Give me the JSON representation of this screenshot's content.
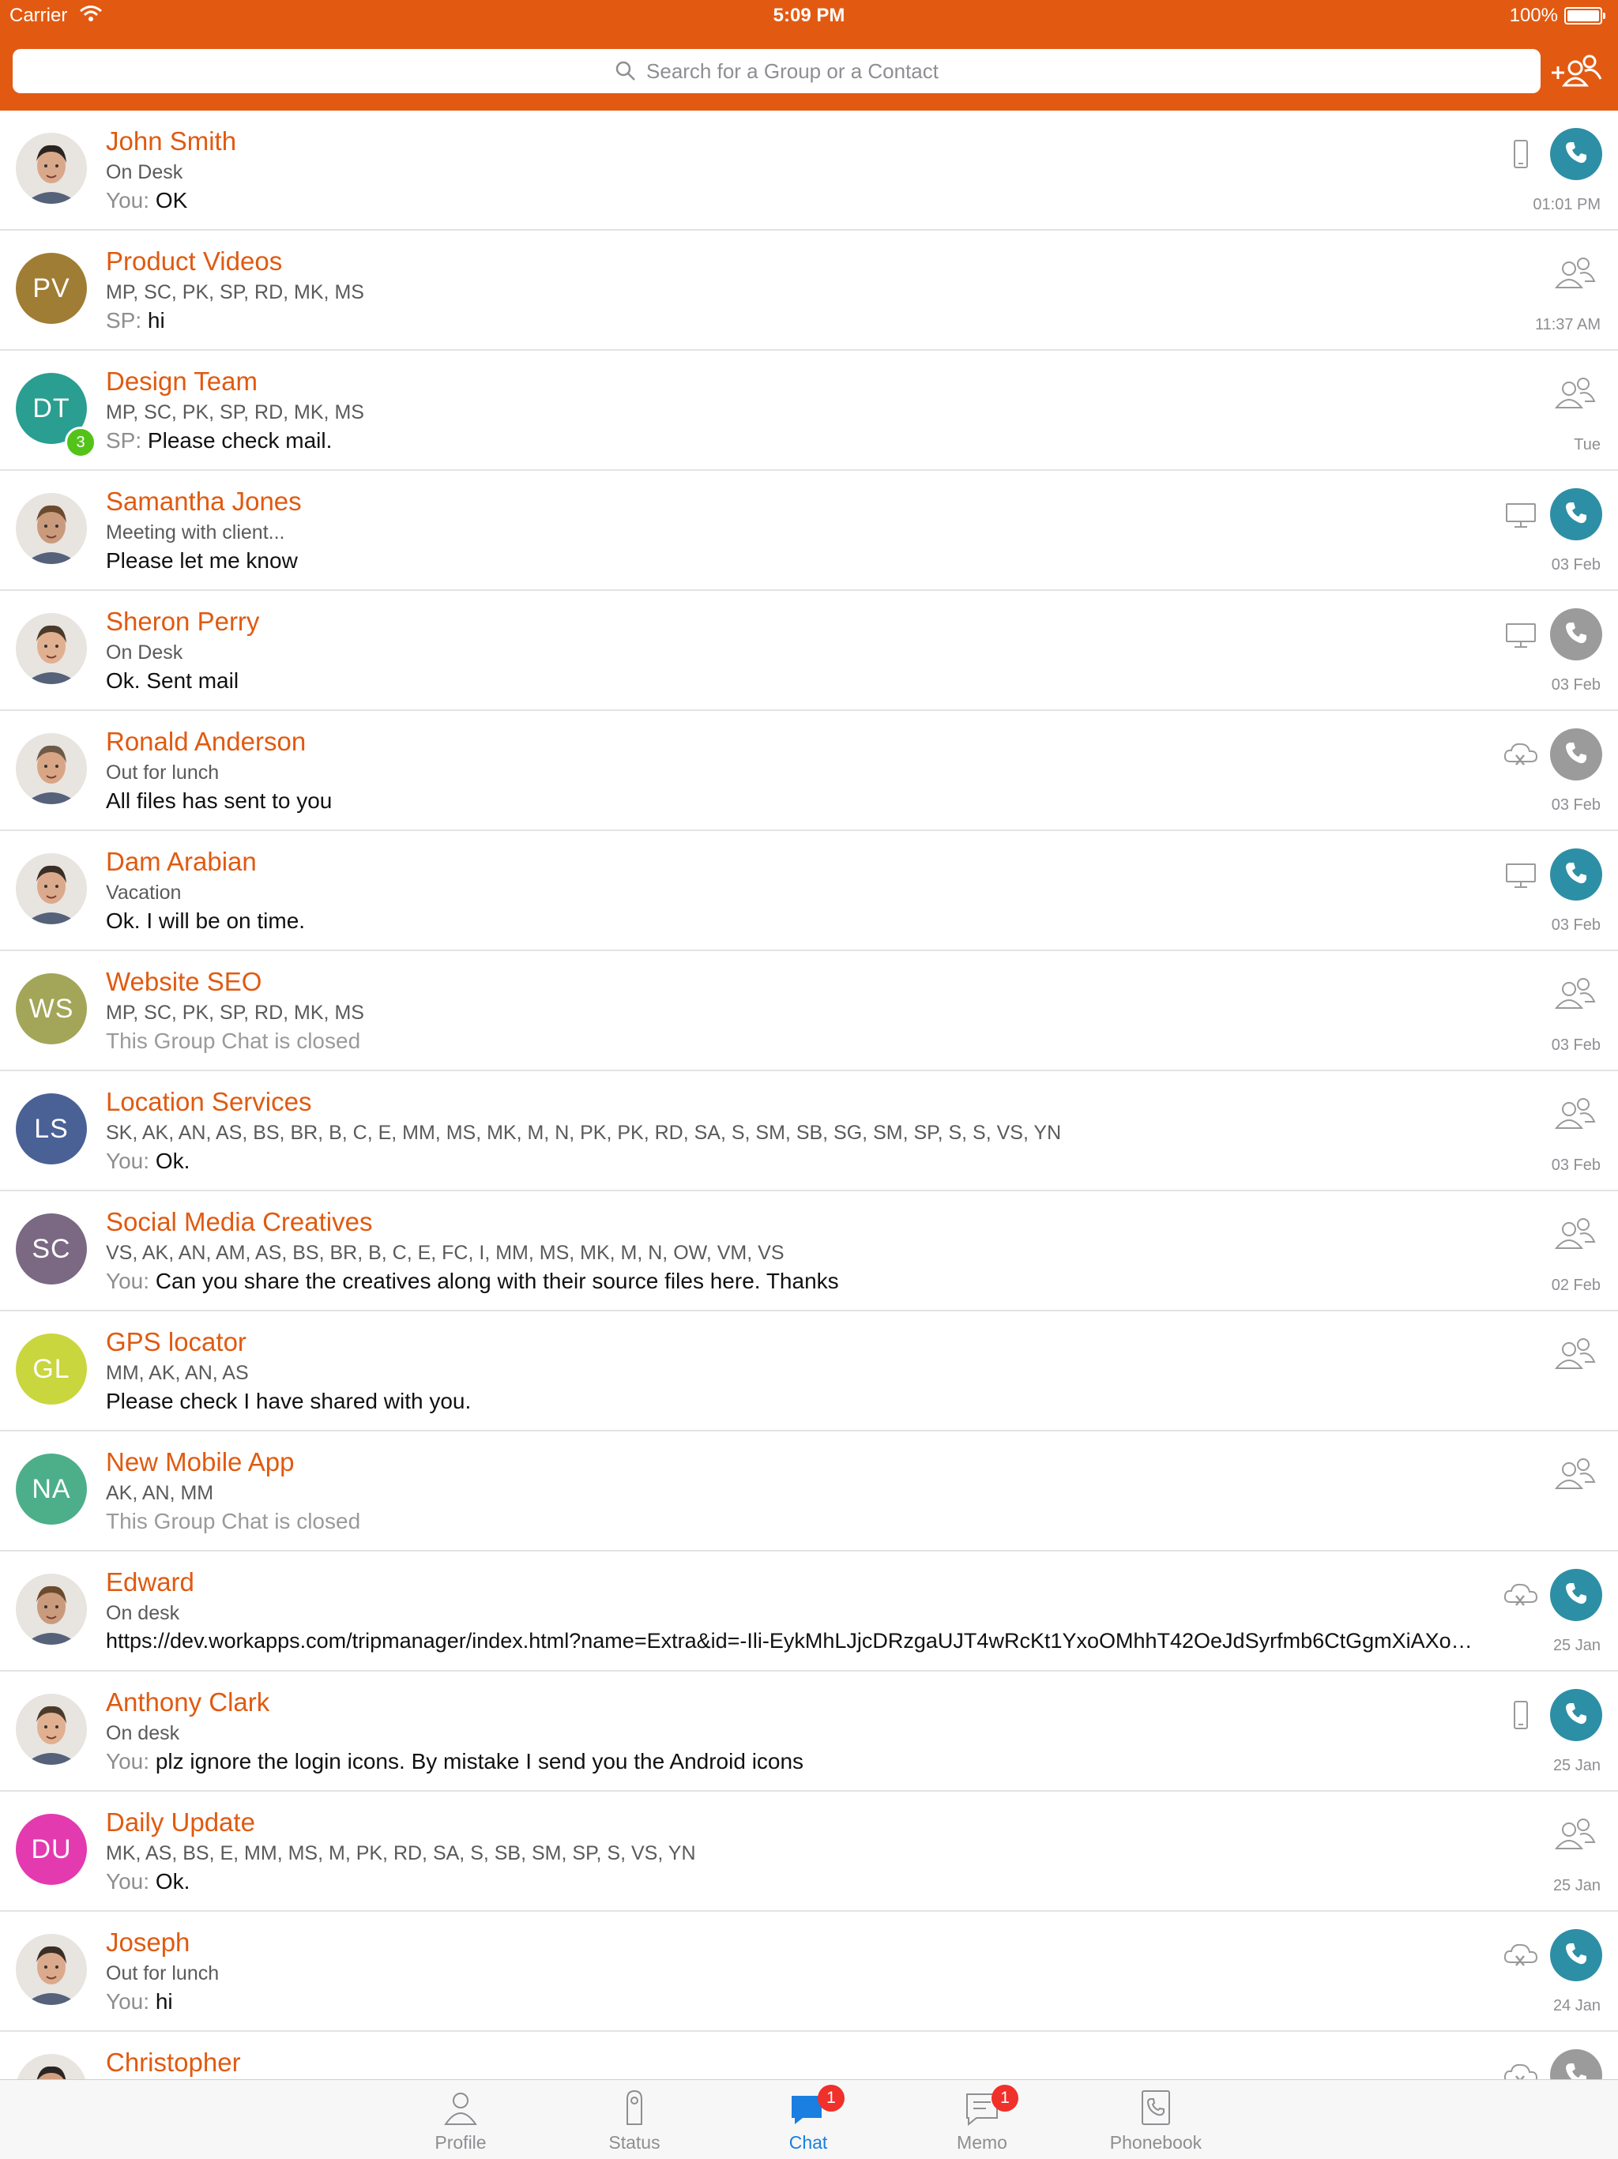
{
  "status_bar": {
    "carrier": "Carrier",
    "time": "5:09 PM",
    "battery": "100%"
  },
  "search": {
    "placeholder": "Search for a Group or a Contact"
  },
  "chats": [
    {
      "name": "John Smith",
      "sub": "On Desk",
      "prefix": "You: ",
      "message": "OK",
      "time": "01:01 PM",
      "status_icon": "mobile-icon",
      "call": "teal"
    },
    {
      "name": "Product Videos",
      "initials": "PV",
      "color": "#a07d34",
      "sub": "MP, SC, PK, SP, RD, MK, MS",
      "prefix": "SP: ",
      "message": "hi",
      "time": "11:37 AM",
      "group": true
    },
    {
      "name": "Design Team",
      "initials": "DT",
      "color": "#2a9e90",
      "badge": "3",
      "sub": "MP, SC, PK, SP, RD, MK, MS",
      "prefix": "SP: ",
      "message": "Please check mail.",
      "time": "Tue",
      "group": true
    },
    {
      "name": "Samantha Jones",
      "sub": "Meeting with client...",
      "prefix": "",
      "message": "Please let me know",
      "time": "03 Feb",
      "status_icon": "desktop-icon",
      "call": "teal"
    },
    {
      "name": "Sheron Perry",
      "sub": "On Desk",
      "prefix": "",
      "message": "Ok. Sent mail",
      "time": "03 Feb",
      "status_icon": "desktop-icon",
      "call": "grey"
    },
    {
      "name": "Ronald Anderson",
      "sub": "Out for lunch",
      "prefix": "",
      "message": "All files has sent to you",
      "time": "03 Feb",
      "status_icon": "offline-cloud-icon",
      "call": "grey"
    },
    {
      "name": "Dam Arabian",
      "sub": "Vacation",
      "prefix": "",
      "message": "Ok. I will be on time.",
      "time": "03 Feb",
      "status_icon": "desktop-icon",
      "call": "teal"
    },
    {
      "name": "Website SEO",
      "initials": "WS",
      "color": "#a3a659",
      "sub": "MP, SC, PK, SP, RD, MK, MS",
      "prefix": "",
      "message": "This Group Chat is closed",
      "closed": true,
      "time": "03 Feb",
      "group": true
    },
    {
      "name": "Location Services",
      "initials": "LS",
      "color": "#4a6195",
      "sub": "SK, AK, AN, AS, BS, BR, B, C, E, MM, MS, MK, M, N, PK, PK, RD, SA, S, SM, SB, SG, SM, SP, S, S, VS, YN",
      "prefix": "You: ",
      "message": "Ok.",
      "time": "03 Feb",
      "group": true
    },
    {
      "name": "Social Media Creatives",
      "initials": "SC",
      "color": "#7b6883",
      "sub": "VS, AK, AN, AM, AS, BS, BR, B, C, E, FC, I, MM, MS, MK, M, N, OW, VM, VS",
      "prefix": "You: ",
      "message": "Can you share the creatives along with their source files here. Thanks",
      "time": "02 Feb",
      "group": true
    },
    {
      "name": "GPS locator",
      "initials": "GL",
      "color": "#c9d63e",
      "sub": "MM, AK, AN, AS",
      "prefix": "",
      "message": "Please check I have shared with you.",
      "time": "",
      "group": true
    },
    {
      "name": "New Mobile App",
      "initials": "NA",
      "color": "#4caf8a",
      "sub": "AK, AN, MM",
      "prefix": "",
      "message": "This Group Chat is closed",
      "closed": true,
      "time": "",
      "group": true
    },
    {
      "name": "Edward",
      "sub": "On desk",
      "prefix": "",
      "message": "https://dev.workapps.com/tripmanager/index.html?name=Extra&id=-Ili-EykMhLJjcDRzgaUJT4wRcKt1YxoOMhhT42OeJdSyrfmb6CtGgmXiAXo…",
      "url": true,
      "time": "25 Jan",
      "status_icon": "offline-cloud-icon",
      "call": "teal"
    },
    {
      "name": "Anthony Clark",
      "sub": "On desk",
      "prefix": "You: ",
      "message": "plz ignore the login icons. By mistake I send you the Android icons",
      "time": "25 Jan",
      "status_icon": "mobile-icon",
      "call": "teal"
    },
    {
      "name": "Daily Update",
      "initials": "DU",
      "color": "#e33ab0",
      "sub": "MK, AS, BS, E, MM, MS, M, PK, RD, SA, S, SB, SM, SP, S, VS, YN",
      "prefix": "You: ",
      "message": "Ok.",
      "time": "25 Jan",
      "group": true
    },
    {
      "name": "Joseph",
      "sub": "Out for lunch",
      "prefix": "You: ",
      "message": "hi",
      "time": "24 Jan",
      "status_icon": "offline-cloud-icon",
      "call": "teal"
    },
    {
      "name": "Christopher",
      "sub": "",
      "prefix": "",
      "message": "",
      "time": "",
      "status_icon": "offline-cloud-icon",
      "call": "grey"
    }
  ],
  "tabs": [
    {
      "label": "Profile",
      "icon": "profile-icon"
    },
    {
      "label": "Status",
      "icon": "status-icon"
    },
    {
      "label": "Chat",
      "icon": "chat-icon",
      "badge": "1",
      "active": true
    },
    {
      "label": "Memo",
      "icon": "memo-icon",
      "badge": "1"
    },
    {
      "label": "Phonebook",
      "icon": "phonebook-icon"
    }
  ],
  "colors": {
    "accent": "#e25a12",
    "name": "#e05a10",
    "call_active": "#2d8fa5",
    "call_idle": "#9b9b9b",
    "tab_active": "#1a7fe0",
    "badge": "#f0302a"
  }
}
